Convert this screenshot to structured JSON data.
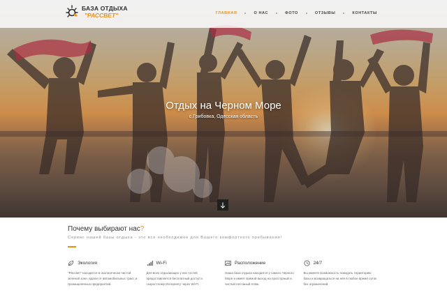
{
  "header": {
    "logo_line1": "БАЗА ОТДЫХА",
    "logo_line2": "\"РАССВЕТ\"",
    "nav": [
      {
        "label": "Главная",
        "active": true
      },
      {
        "label": "О нас",
        "active": false
      },
      {
        "label": "Фото",
        "active": false
      },
      {
        "label": "Отзывы",
        "active": false
      },
      {
        "label": "Контакты",
        "active": false
      }
    ]
  },
  "hero": {
    "title": "Отдых на Черном Море",
    "subtitle": "с.Грибовка, Одесская область",
    "scroll_icon": "arrow-down-icon"
  },
  "why": {
    "title": "Почему выбирают нас",
    "title_mark": "?",
    "subtitle": "Сервис нашей базы отдыха - это все необходимое для Вашего комфортного пребывания!"
  },
  "features": [
    {
      "icon": "leaf-icon",
      "title": "Экология",
      "text": "\"Рассвет\" находится в экологически чистой зеленой зоне, вдали от автомобильных трасс и промышленных предприятий."
    },
    {
      "icon": "signal-icon",
      "title": "Wi-Fi",
      "text": "Для всех отдыхающих у нас гостей предоставляется бесплатный доступ к скоростному Интернету через Wi-Fi."
    },
    {
      "icon": "image-icon",
      "title": "Расположение",
      "text": "Наша база отдыха находится у самого Черного Моря и имеет прямой выход на просторный и чистый песчаный пляж."
    },
    {
      "icon": "clock-icon",
      "title": "24/7",
      "text": "Вы имеете возможность покидать территорию базы и возвращаться на нее в любое время суток без ограничений."
    }
  ],
  "colors": {
    "accent": "#e8901a",
    "text_dark": "#333333",
    "text_muted": "#8a8a8a"
  }
}
